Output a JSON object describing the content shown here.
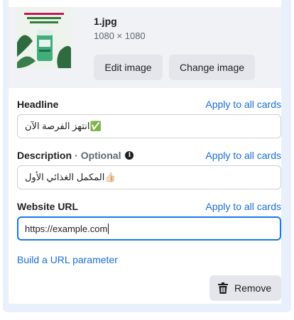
{
  "media": {
    "file_name": "1.jpg",
    "dimensions": "1080 × 1080",
    "edit_label": "Edit image",
    "change_label": "Change image"
  },
  "headline": {
    "label": "Headline",
    "apply_label": "Apply to all cards",
    "value": "انتهز الفرصة الآن✅"
  },
  "description": {
    "label": "Description",
    "separator": "·",
    "optional": "Optional",
    "apply_label": "Apply to all cards",
    "value": "المكمل الغذائي الأول👍🏻"
  },
  "website_url": {
    "label": "Website URL",
    "apply_label": "Apply to all cards",
    "value": "https://example.com"
  },
  "url_parameter_label": "Build a URL parameter",
  "remove_label": "Remove",
  "colors": {
    "link": "#1a6ed8",
    "focus_border": "#1877f2",
    "panel_bg": "#e7f0fb",
    "media_bg": "#f0f2f5",
    "button_bg": "#e4e6eb"
  }
}
